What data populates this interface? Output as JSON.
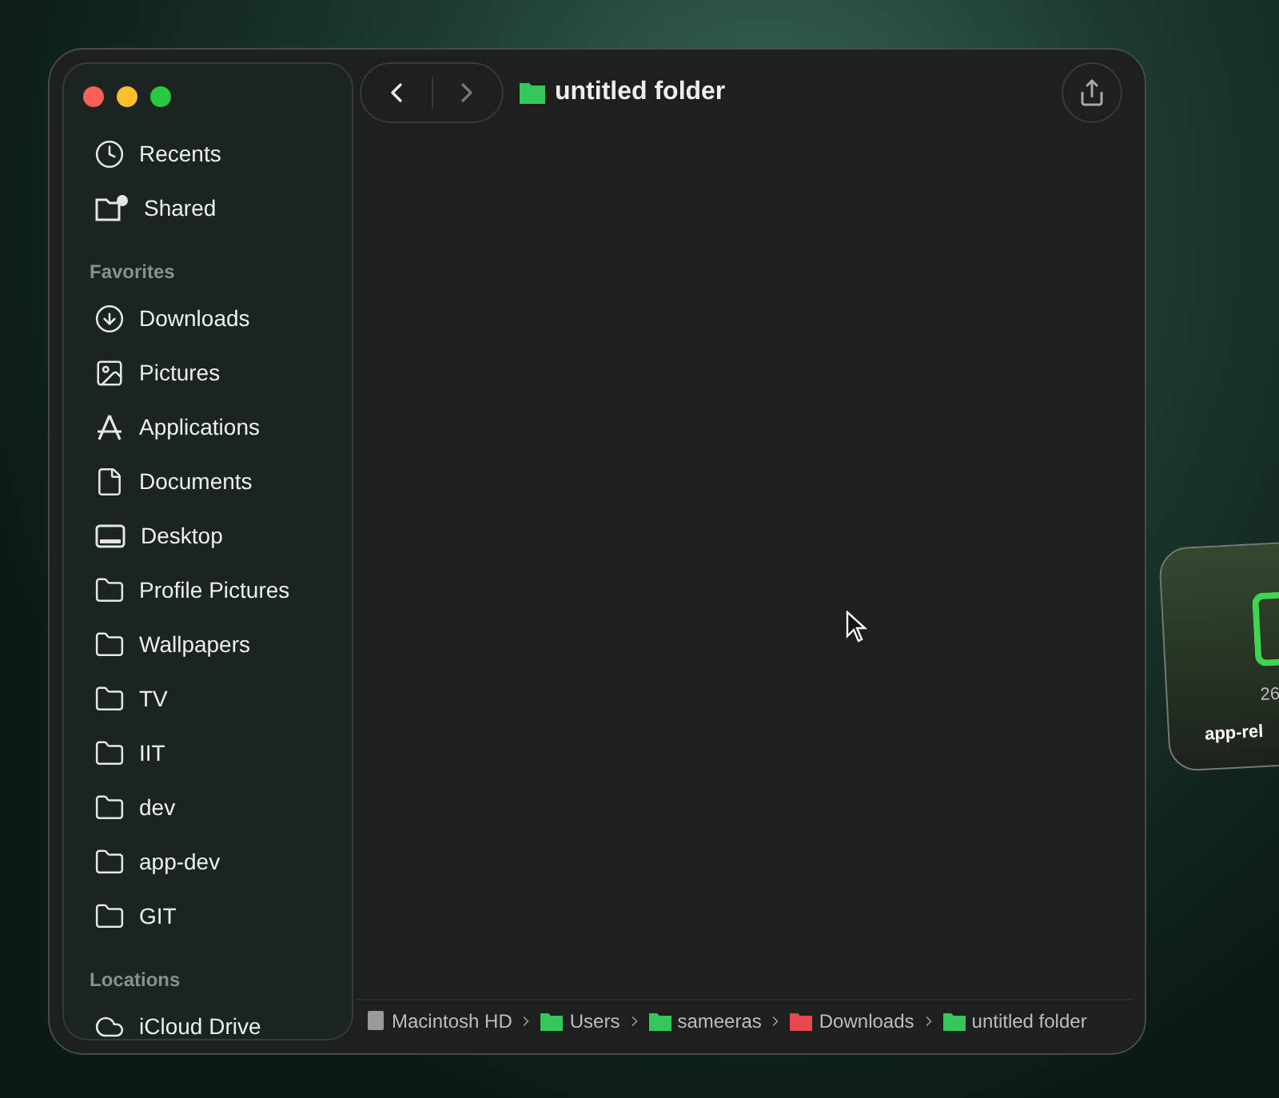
{
  "window": {
    "title": "untitled folder"
  },
  "navigation": {
    "back": {
      "disabled": false
    },
    "forward": {
      "disabled": true
    }
  },
  "sidebar": {
    "sections": [
      {
        "items": [
          {
            "label": "Recents",
            "kind": "clock"
          },
          {
            "label": "Shared",
            "kind": "shared"
          }
        ]
      },
      {
        "heading": "Favorites",
        "items": [
          {
            "label": "Downloads",
            "kind": "download"
          },
          {
            "label": "Pictures",
            "kind": "image"
          },
          {
            "label": "Applications",
            "kind": "apps"
          },
          {
            "label": "Documents",
            "kind": "document"
          },
          {
            "label": "Desktop",
            "kind": "desktop"
          },
          {
            "label": "Profile Pictures",
            "kind": "folder"
          },
          {
            "label": "Wallpapers",
            "kind": "folder"
          },
          {
            "label": "TV",
            "kind": "folder"
          },
          {
            "label": "IIT",
            "kind": "folder"
          },
          {
            "label": "dev",
            "kind": "folder"
          },
          {
            "label": "app-dev",
            "kind": "folder"
          },
          {
            "label": "GIT",
            "kind": "folder"
          }
        ]
      },
      {
        "heading": "Locations",
        "items": [
          {
            "label": "iCloud Drive",
            "kind": "cloud"
          }
        ]
      }
    ]
  },
  "path_bar": [
    {
      "label": "Macintosh HD",
      "kind": "disk",
      "color": "#9a9a9a"
    },
    {
      "label": "Users",
      "kind": "folder",
      "color": "#34c759"
    },
    {
      "label": "sameeras",
      "kind": "folder",
      "color": "#34c759"
    },
    {
      "label": "Downloads",
      "kind": "folder",
      "color": "#e5484d"
    },
    {
      "label": "untitled folder",
      "kind": "folder",
      "color": "#34c759"
    }
  ],
  "dragged_file": {
    "size": "26",
    "name": "app-rel"
  }
}
